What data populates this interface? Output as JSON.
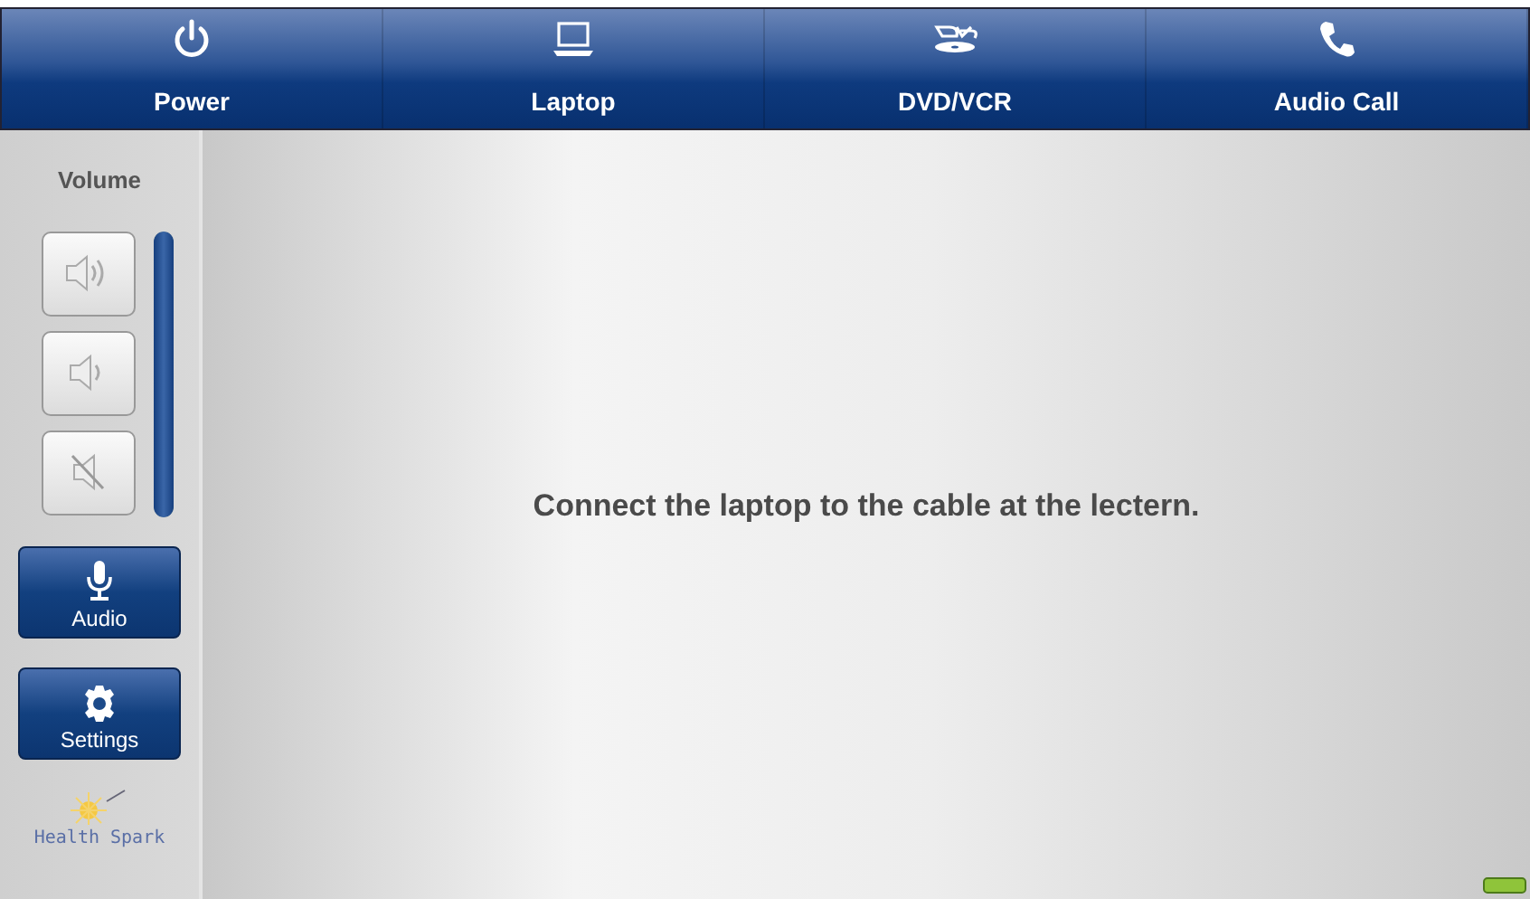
{
  "sources": [
    {
      "label": "Power",
      "kind": "power"
    },
    {
      "label": "Laptop",
      "kind": "laptop"
    },
    {
      "label": "DVD/VCR",
      "kind": "dvd"
    },
    {
      "label": "Audio Call",
      "kind": "phone"
    }
  ],
  "volume": {
    "title": "Volume",
    "level": 1,
    "buttons": [
      {
        "kind": "up"
      },
      {
        "kind": "down"
      },
      {
        "kind": "mute"
      }
    ]
  },
  "side_buttons": [
    {
      "label": "Audio",
      "kind": "mic"
    },
    {
      "label": "Settings",
      "kind": "gear"
    }
  ],
  "logo": {
    "left": "Health",
    "right": "Spark"
  },
  "message": "Connect the laptop to the cable at the lectern."
}
